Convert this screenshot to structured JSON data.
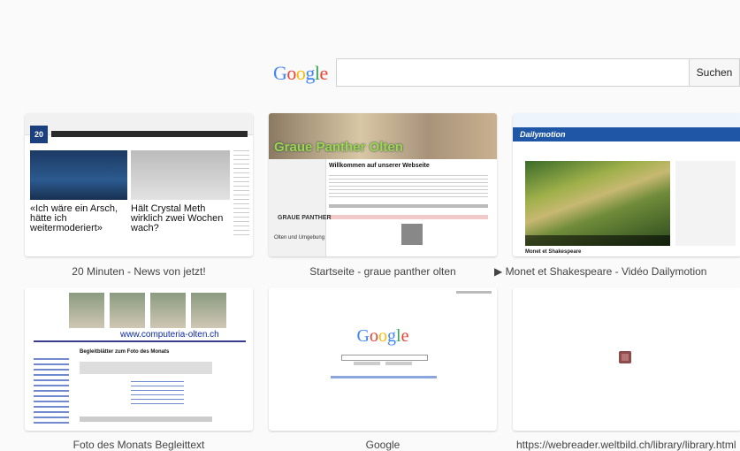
{
  "search": {
    "logo": "Google",
    "query_value": "",
    "button_label": "Suchen"
  },
  "tiles": [
    {
      "caption": "20 Minuten - News von jetzt!",
      "logo_text": "20",
      "headline_left": "«Ich wäre ein Arsch, hätte ich weitermoderiert»",
      "headline_right": "Hält Crystal Meth wirklich zwei Wochen wach?"
    },
    {
      "caption": "Startseite - graue panther olten",
      "banner_title": "Graue Panther Olten",
      "welcome": "Willkommen auf unserer Webseite",
      "sub_logo": "GRAUE PANTHER",
      "sub_text": "Olten und Umgebung"
    },
    {
      "caption": "▶ Monet et Shakespeare - Vidéo Dailymotion",
      "site_logo": "Dailymotion",
      "video_title": "Monet et Shakespeare"
    },
    {
      "caption": "Foto des Monats Begleittext",
      "url_text": "www.computeria-olten.ch",
      "heading": "Begleitblätter zum Foto des Monats"
    },
    {
      "caption": "Google",
      "logo": "Google"
    },
    {
      "caption": "https://webreader.weltbild.ch/library/library.html"
    }
  ],
  "colors": {
    "google_blue": "#4285f4",
    "google_red": "#ea4335",
    "google_yellow": "#fbbc05",
    "google_green": "#34a853"
  }
}
